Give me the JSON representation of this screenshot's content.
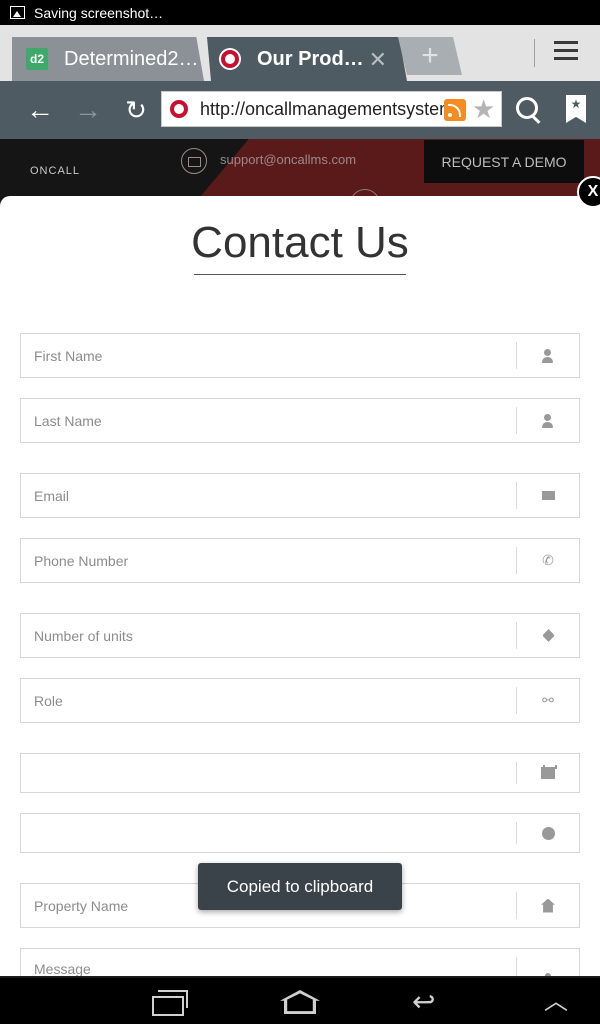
{
  "status_bar": {
    "notification": "Saving screenshot…"
  },
  "browser": {
    "tabs": [
      {
        "title": "Determined2…",
        "favicon": "d2"
      },
      {
        "title": "Our Prod…",
        "favicon": "oncall-ring"
      }
    ],
    "new_tab": "+",
    "tab_close": "✕",
    "url": "http://oncallmanagementsystems.com",
    "nav": {
      "back": "←",
      "forward": "→",
      "reload": "↻"
    }
  },
  "page_header": {
    "logo": "ONCALL",
    "support_email": "support@oncallms.com",
    "demo_button": "REQUEST A DEMO"
  },
  "modal": {
    "close_label": "X",
    "title": "Contact Us",
    "fields": {
      "first_name": "First Name",
      "last_name": "Last Name",
      "email": "Email",
      "phone": "Phone Number",
      "units": "Number of units",
      "role": "Role",
      "date": "",
      "time": "",
      "property": "Property Name",
      "message": "Message"
    }
  },
  "toast": "Copied to clipboard",
  "colors": {
    "toolbar": "#4f5b63",
    "brand_red": "#c8102e",
    "rss": "#f48c21"
  }
}
